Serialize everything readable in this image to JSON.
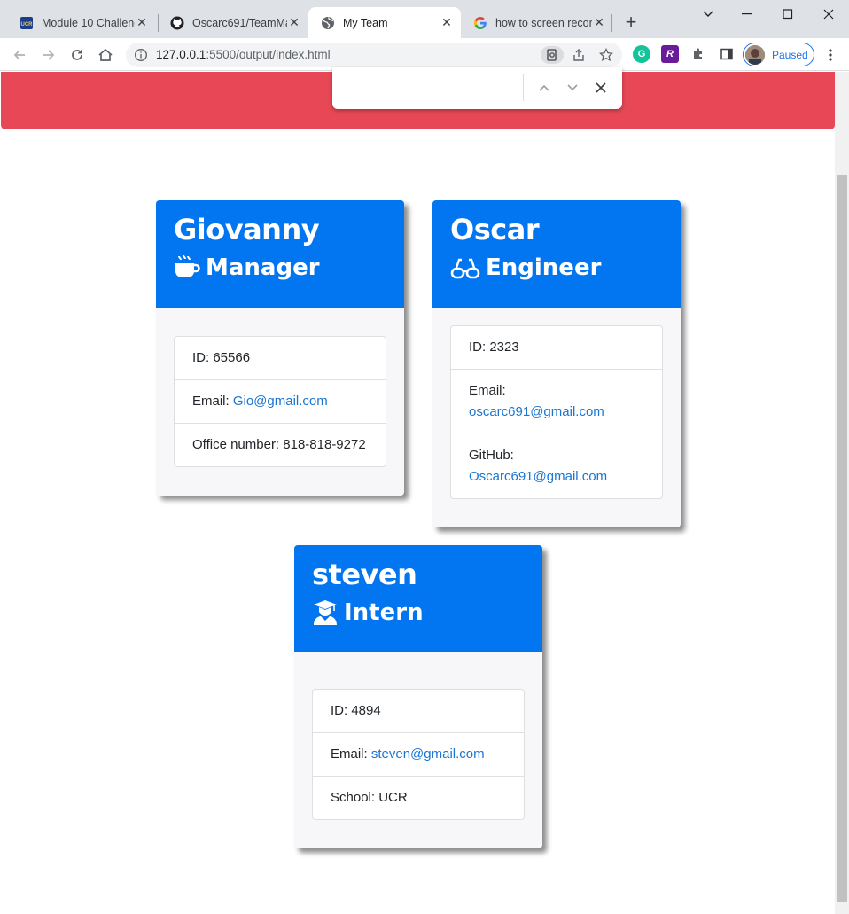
{
  "browser": {
    "tabs": [
      {
        "title": "Module 10 Challenge",
        "active": false,
        "favicon": "ucr-icon"
      },
      {
        "title": "Oscarc691/TeamMa",
        "active": false,
        "favicon": "github-icon"
      },
      {
        "title": "My Team",
        "active": true,
        "favicon": "globe-icon"
      },
      {
        "title": "how to screen recor",
        "active": false,
        "favicon": "google-icon"
      }
    ],
    "url_host": "127.0.0.1",
    "url_path": ":5500/output/index.html",
    "profile_label": "Paused",
    "find_query": ""
  },
  "colors": {
    "banner": "#e84855",
    "card_header": "#0275f0",
    "link": "#1976d2"
  },
  "team": [
    {
      "name": "Giovanny",
      "role": "Manager",
      "icon": "coffee-mug-icon",
      "id_label": "ID: 65566",
      "email_label": "Email: ",
      "email": "Gio@gmail.com",
      "extra_label": "Office number: 818-818-9272"
    },
    {
      "name": "Oscar",
      "role": "Engineer",
      "icon": "glasses-icon",
      "id_label": "ID: 2323",
      "email_label": "Email: ",
      "email": "oscarc691@gmail.com",
      "extra_label": "GitHub: ",
      "extra_link": "Oscarc691@gmail.com"
    },
    {
      "name": "steven",
      "role": "Intern",
      "icon": "graduate-icon",
      "id_label": "ID: 4894",
      "email_label": "Email: ",
      "email": "steven@gmail.com",
      "extra_label": "School: UCR"
    }
  ]
}
